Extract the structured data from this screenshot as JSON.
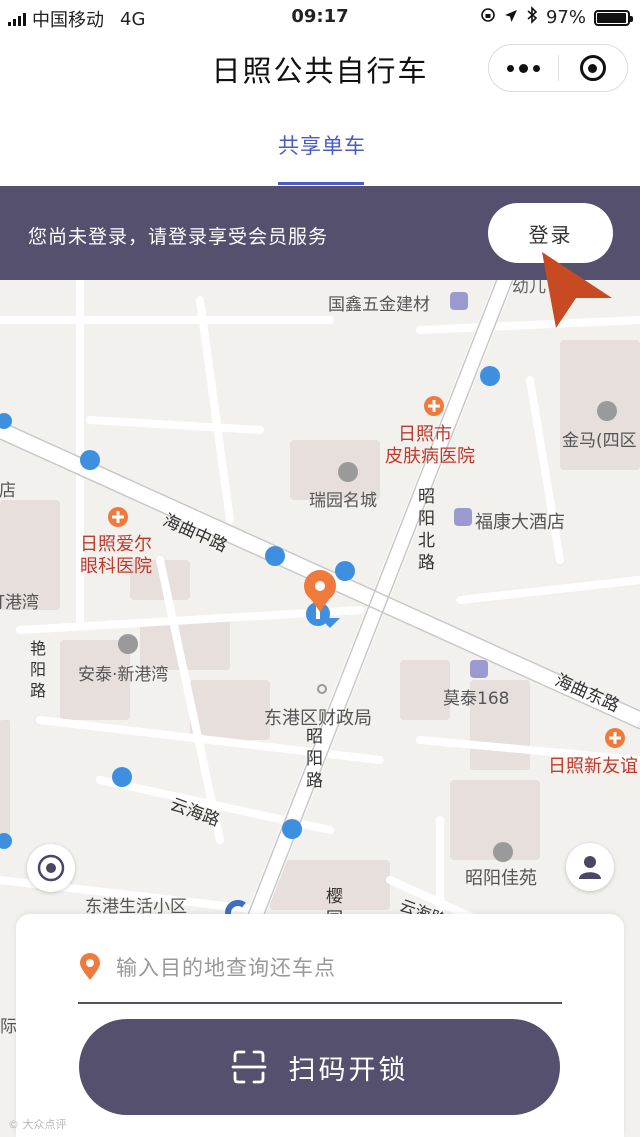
{
  "status_bar": {
    "carrier": "中国移动",
    "network": "4G",
    "time": "09:17",
    "battery": "97%",
    "battery_level": 0.97
  },
  "nav": {
    "title": "日照公共自行车"
  },
  "tabs": [
    {
      "label": "共享单车",
      "active": true
    }
  ],
  "login_banner": {
    "message": "您尚未登录，请登录享受会员服务",
    "button": "登录"
  },
  "map": {
    "labels": [
      {
        "id": "guoxin",
        "text": "国鑫五金建材"
      },
      {
        "id": "youer",
        "text": "幼儿"
      },
      {
        "id": "jinma",
        "text": "金马(四区"
      },
      {
        "id": "skin1",
        "text": "日照市"
      },
      {
        "id": "skin2",
        "text": "皮肤病医院"
      },
      {
        "id": "ruiyuan",
        "text": "瑞园名城"
      },
      {
        "id": "fukang",
        "text": "福康大酒店"
      },
      {
        "id": "haiqu-zhong",
        "text": "海曲中路"
      },
      {
        "id": "zhaoyang-bei",
        "text": "昭阳北路"
      },
      {
        "id": "aier1",
        "text": "日照爱尔"
      },
      {
        "id": "aier2",
        "text": "眼科医院"
      },
      {
        "id": "gangwan",
        "text": "打港湾"
      },
      {
        "id": "dian",
        "text": "商店"
      },
      {
        "id": "yanyang",
        "text": "艳阳路"
      },
      {
        "id": "antai",
        "text": "安泰·新港湾"
      },
      {
        "id": "motai",
        "text": "莫泰168"
      },
      {
        "id": "haiqu-dong",
        "text": "海曲东路"
      },
      {
        "id": "caizheng",
        "text": "东港区财政局"
      },
      {
        "id": "xinyou",
        "text": "日照新友谊"
      },
      {
        "id": "zhaoyang",
        "text": "昭阳路"
      },
      {
        "id": "yunhai1",
        "text": "云海路"
      },
      {
        "id": "zhaoyang-jiayuan",
        "text": "昭阳佳苑"
      },
      {
        "id": "shenghuo",
        "text": "东港生活小区"
      },
      {
        "id": "ying",
        "text": "樱园"
      },
      {
        "id": "yunhai2",
        "text": "云海路"
      },
      {
        "id": "ji",
        "text": "际"
      }
    ]
  },
  "bottom_panel": {
    "destination_placeholder": "输入目的地查询还车点",
    "scan_button": "扫码开锁"
  },
  "watermark": "© 大众点评",
  "colors": {
    "accent_blue": "#4a5cc4",
    "brand_purple": "#55506d",
    "pin_orange": "#f07a3c",
    "poi_red": "#c0392b",
    "arrow": "#c84a22"
  }
}
